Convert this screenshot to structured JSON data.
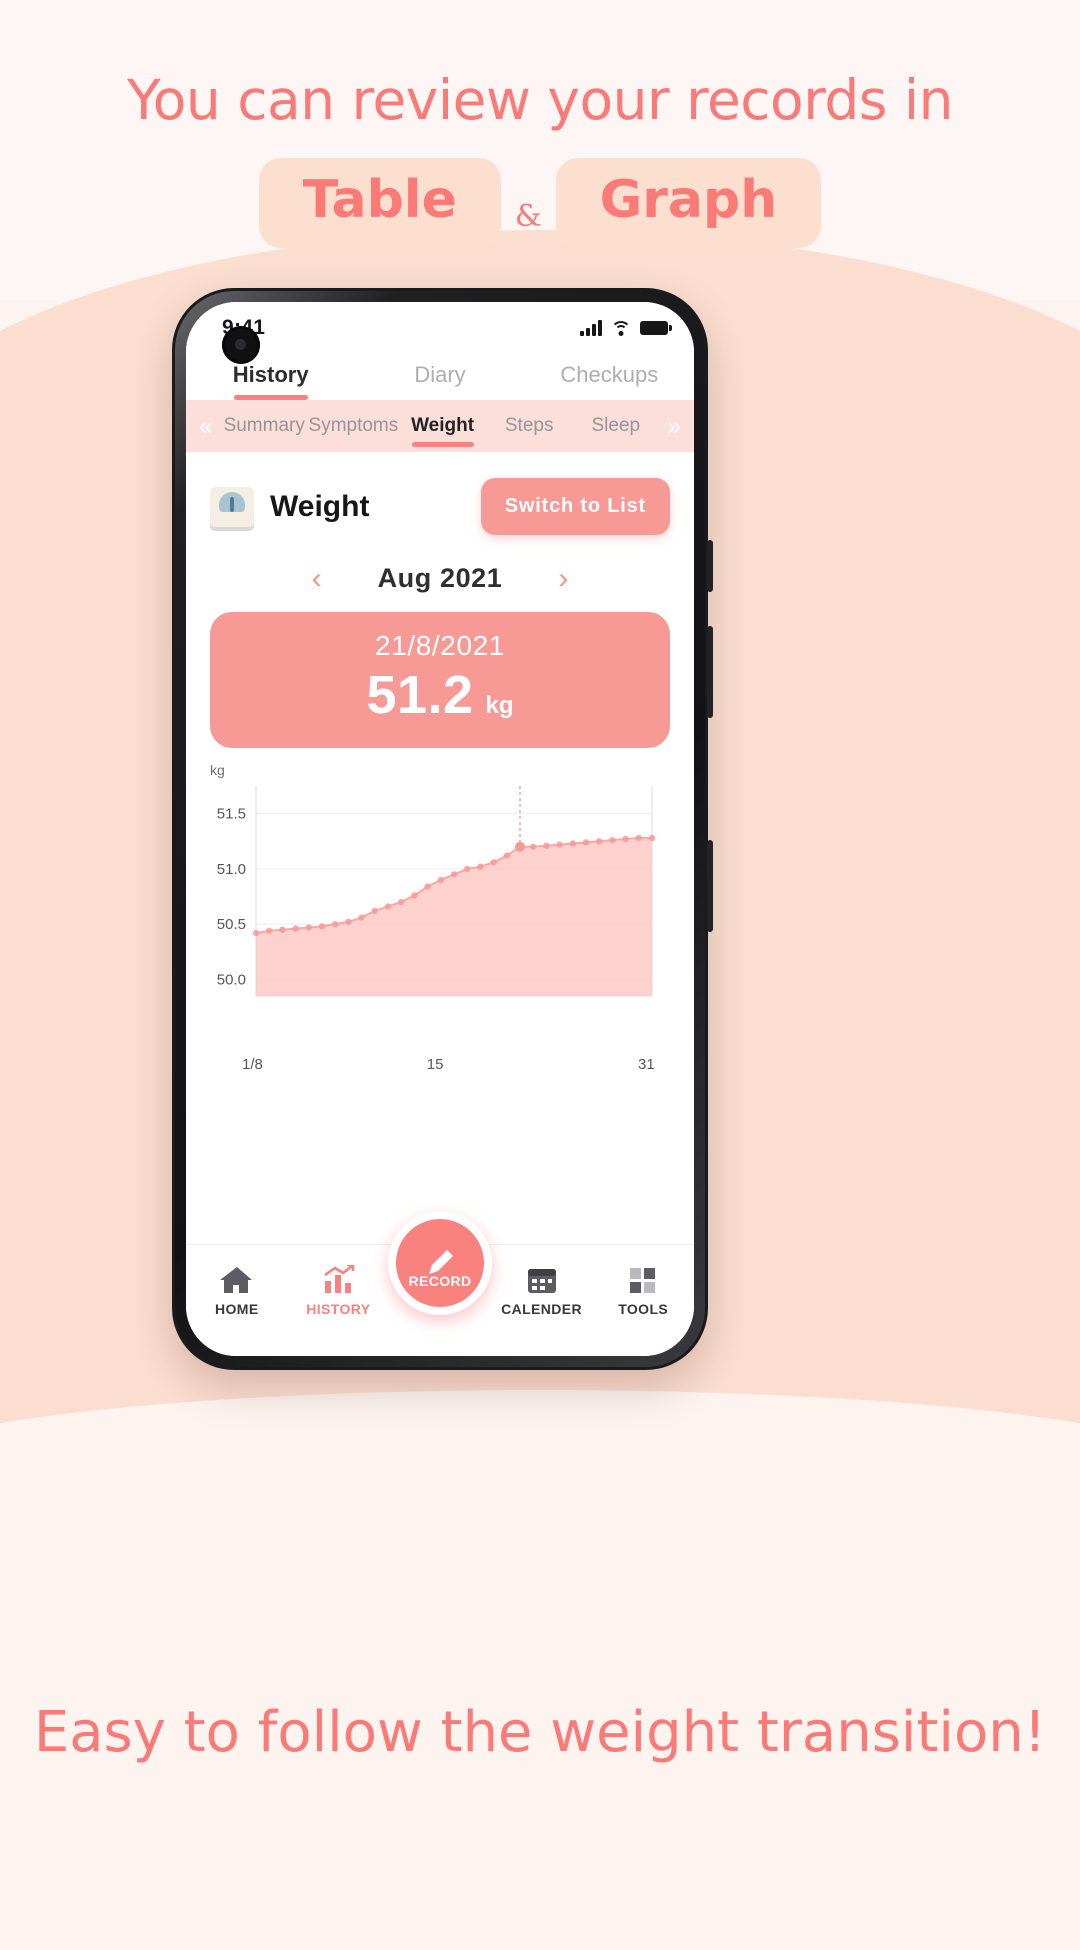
{
  "promo": {
    "headline": "You can review your records in",
    "badge_table": "Table",
    "ampersand": "&",
    "badge_graph": "Graph",
    "footer": "Easy to follow the weight transition!",
    "accent_color": "#fa7a77",
    "badge_bg": "#fddfd0"
  },
  "status_bar": {
    "time": "9:41",
    "signal_icon": "cellular-signal-icon",
    "wifi_icon": "wifi-icon",
    "battery_icon": "battery-full-icon"
  },
  "main_tabs": [
    {
      "label": "History",
      "active": true
    },
    {
      "label": "Diary",
      "active": false
    },
    {
      "label": "Checkups",
      "active": false
    }
  ],
  "sub_tabs": {
    "prev_icon": "«",
    "next_icon": "»",
    "items": [
      {
        "label": "Summary",
        "active": false
      },
      {
        "label": "Symptoms",
        "active": false
      },
      {
        "label": "Weight",
        "active": true
      },
      {
        "label": "Steps",
        "active": false
      },
      {
        "label": "Sleep",
        "active": false
      }
    ]
  },
  "section": {
    "icon": "weight-scale-icon",
    "title": "Weight",
    "switch_button": "Switch to List"
  },
  "month_nav": {
    "prev": "‹",
    "label": "Aug 2021",
    "next": "›"
  },
  "value_card": {
    "date": "21/8/2021",
    "value": "51.2",
    "unit": "kg",
    "bg": "#f79a96"
  },
  "chart_data": {
    "type": "area",
    "title": "",
    "xlabel": "",
    "ylabel": "kg",
    "unit_label": "kg",
    "ylim": [
      49.85,
      51.75
    ],
    "yticks": [
      "50.0",
      "50.5",
      "51.0",
      "51.5"
    ],
    "ytick_values": [
      50.0,
      50.5,
      51.0,
      51.5
    ],
    "xticks": [
      "1/8",
      "15",
      "31"
    ],
    "xtick_days": [
      1,
      15,
      31
    ],
    "grid": true,
    "line_color": "#f9a8a3",
    "fill_color": "#fcc9c5",
    "marker_color": "#f79a96",
    "highlight_day": 21,
    "highlight_value": 51.2,
    "x": [
      1,
      2,
      3,
      4,
      5,
      6,
      7,
      8,
      9,
      10,
      11,
      12,
      13,
      14,
      15,
      16,
      17,
      18,
      19,
      20,
      21,
      22,
      23,
      24,
      25,
      26,
      27,
      28,
      29,
      30,
      31
    ],
    "values": [
      50.42,
      50.44,
      50.45,
      50.46,
      50.47,
      50.48,
      50.5,
      50.52,
      50.56,
      50.62,
      50.66,
      50.7,
      50.76,
      50.84,
      50.9,
      50.95,
      51.0,
      51.02,
      51.06,
      51.12,
      51.2,
      51.2,
      51.21,
      51.22,
      51.23,
      51.24,
      51.25,
      51.26,
      51.27,
      51.28,
      51.28
    ]
  },
  "bottom_nav": [
    {
      "label": "HOME",
      "icon": "home-icon",
      "active": false
    },
    {
      "label": "HISTORY",
      "icon": "chart-bars-icon",
      "active": true
    },
    {
      "label": "RECORD",
      "icon": "pencil-icon",
      "active": false
    },
    {
      "label": "CALENDER",
      "icon": "calendar-icon",
      "active": false
    },
    {
      "label": "TOOLS",
      "icon": "grid-blocks-icon",
      "active": false
    }
  ]
}
